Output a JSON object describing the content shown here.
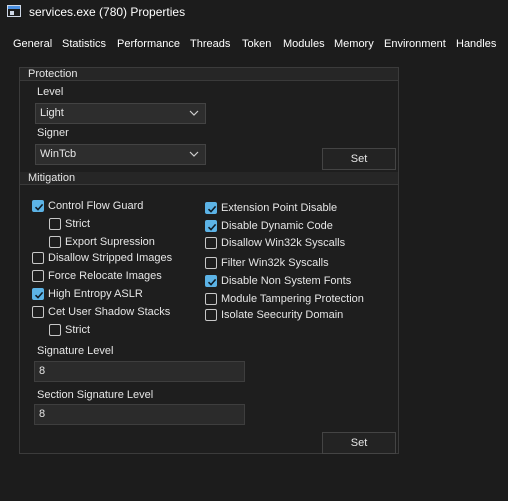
{
  "window": {
    "title": "services.exe (780) Properties"
  },
  "tabs": [
    "General",
    "Statistics",
    "Performance",
    "Threads",
    "Token",
    "Modules",
    "Memory",
    "Environment",
    "Handles"
  ],
  "protection": {
    "header": "Protection",
    "level_label": "Level",
    "level_value": "Light",
    "signer_label": "Signer",
    "signer_value": "WinTcb",
    "set_label": "Set"
  },
  "mitigation": {
    "header": "Mitigation",
    "checkboxes": [
      {
        "label": "Control Flow Guard",
        "checked": true
      },
      {
        "label": "Strict",
        "checked": false
      },
      {
        "label": "Export Supression",
        "checked": false
      },
      {
        "label": "Disallow Stripped Images",
        "checked": false
      },
      {
        "label": "Force Relocate Images",
        "checked": false
      },
      {
        "label": "High Entropy ASLR",
        "checked": true
      },
      {
        "label": "Cet User Shadow Stacks",
        "checked": false
      },
      {
        "label": "Strict",
        "checked": false
      },
      {
        "label": "Extension Point Disable",
        "checked": true
      },
      {
        "label": "Disable Dynamic Code",
        "checked": true
      },
      {
        "label": "Disallow Win32k Syscalls",
        "checked": false
      },
      {
        "label": "Filter Win32k Syscalls",
        "checked": false
      },
      {
        "label": "Disable Non System Fonts",
        "checked": true
      },
      {
        "label": "Module Tampering Protection",
        "checked": false
      },
      {
        "label": "Isolate Seecurity Domain",
        "checked": false
      }
    ],
    "signature_level_label": "Signature Level",
    "signature_level_value": "8",
    "section_signature_level_label": "Section Signature Level",
    "section_signature_level_value": "8",
    "set_label": "Set"
  },
  "colors": {
    "accent": "#5cb3e6",
    "background": "#1c1c1c"
  }
}
